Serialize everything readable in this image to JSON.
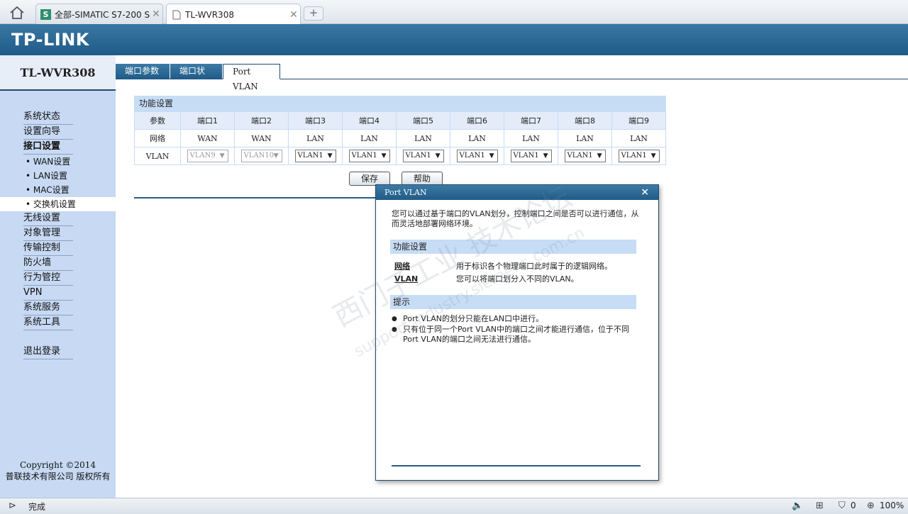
{
  "browser": {
    "tabs": [
      {
        "label": "全部-SIMATIC S7-200 S",
        "active": false,
        "icon": "siemens-s-icon"
      },
      {
        "label": "TL-WVR308",
        "active": true,
        "icon": "page-icon"
      }
    ],
    "newtab": "+",
    "status_text": "完成",
    "zoom": "100%",
    "shield_count": "0"
  },
  "brand": {
    "logo": "TP-LINK",
    "model": "TL-WVR308"
  },
  "sidebar": {
    "items": [
      {
        "label": "系统状态"
      },
      {
        "label": "设置向导"
      },
      {
        "label": "接口设置"
      },
      {
        "label": "• WAN设置"
      },
      {
        "label": "• LAN设置"
      },
      {
        "label": "• MAC设置"
      },
      {
        "label": "• 交换机设置"
      },
      {
        "label": "无线设置"
      },
      {
        "label": "对象管理"
      },
      {
        "label": "传输控制"
      },
      {
        "label": "防火墙"
      },
      {
        "label": "行为管控"
      },
      {
        "label": "VPN"
      },
      {
        "label": "系统服务"
      },
      {
        "label": "系统工具"
      },
      {
        "label": "退出登录"
      }
    ],
    "copyright_line1": "Copyright ©2014",
    "copyright_line2": "普联技术有限公司 版权所有"
  },
  "content_tabs": [
    {
      "label": "端口参数"
    },
    {
      "label": "端口状态"
    },
    {
      "label": "Port VLAN"
    }
  ],
  "table": {
    "section_title": "功能设置",
    "headers": [
      "参数",
      "端口1",
      "端口2",
      "端口3",
      "端口4",
      "端口5",
      "端口6",
      "端口7",
      "端口8",
      "端口9"
    ],
    "network_label": "网络",
    "network": [
      "WAN",
      "WAN",
      "LAN",
      "LAN",
      "LAN",
      "LAN",
      "LAN",
      "LAN",
      "LAN"
    ],
    "vlan_label": "VLAN",
    "vlan": [
      "VLAN9",
      "VLAN10",
      "VLAN1",
      "VLAN1",
      "VLAN1",
      "VLAN1",
      "VLAN1",
      "VLAN1",
      "VLAN1"
    ],
    "arrow": "▼"
  },
  "buttons": {
    "save": "保存",
    "help": "帮助"
  },
  "popup": {
    "title": "Port VLAN",
    "close": "×",
    "description": "您可以通过基于端口的VLAN划分，控制端口之间是否可以进行通信，从而灵活地部署网络环境。",
    "section1": "功能设置",
    "rows": [
      {
        "term": "网络",
        "desc": "用于标识各个物理端口此时属于的逻辑网络。"
      },
      {
        "term": "VLAN",
        "desc": "您可以将端口划分入不同的VLAN。"
      }
    ],
    "section2": "提示",
    "tips": [
      "Port VLAN的划分只能在LAN口中进行。",
      "只有位于同一个Port VLAN中的端口之间才能进行通信，位于不同Port VLAN的端口之间无法进行通信。"
    ]
  },
  "watermark": {
    "line1": "西门子工业 技术论坛",
    "line2": "support.industry.siemens.com.cn"
  }
}
